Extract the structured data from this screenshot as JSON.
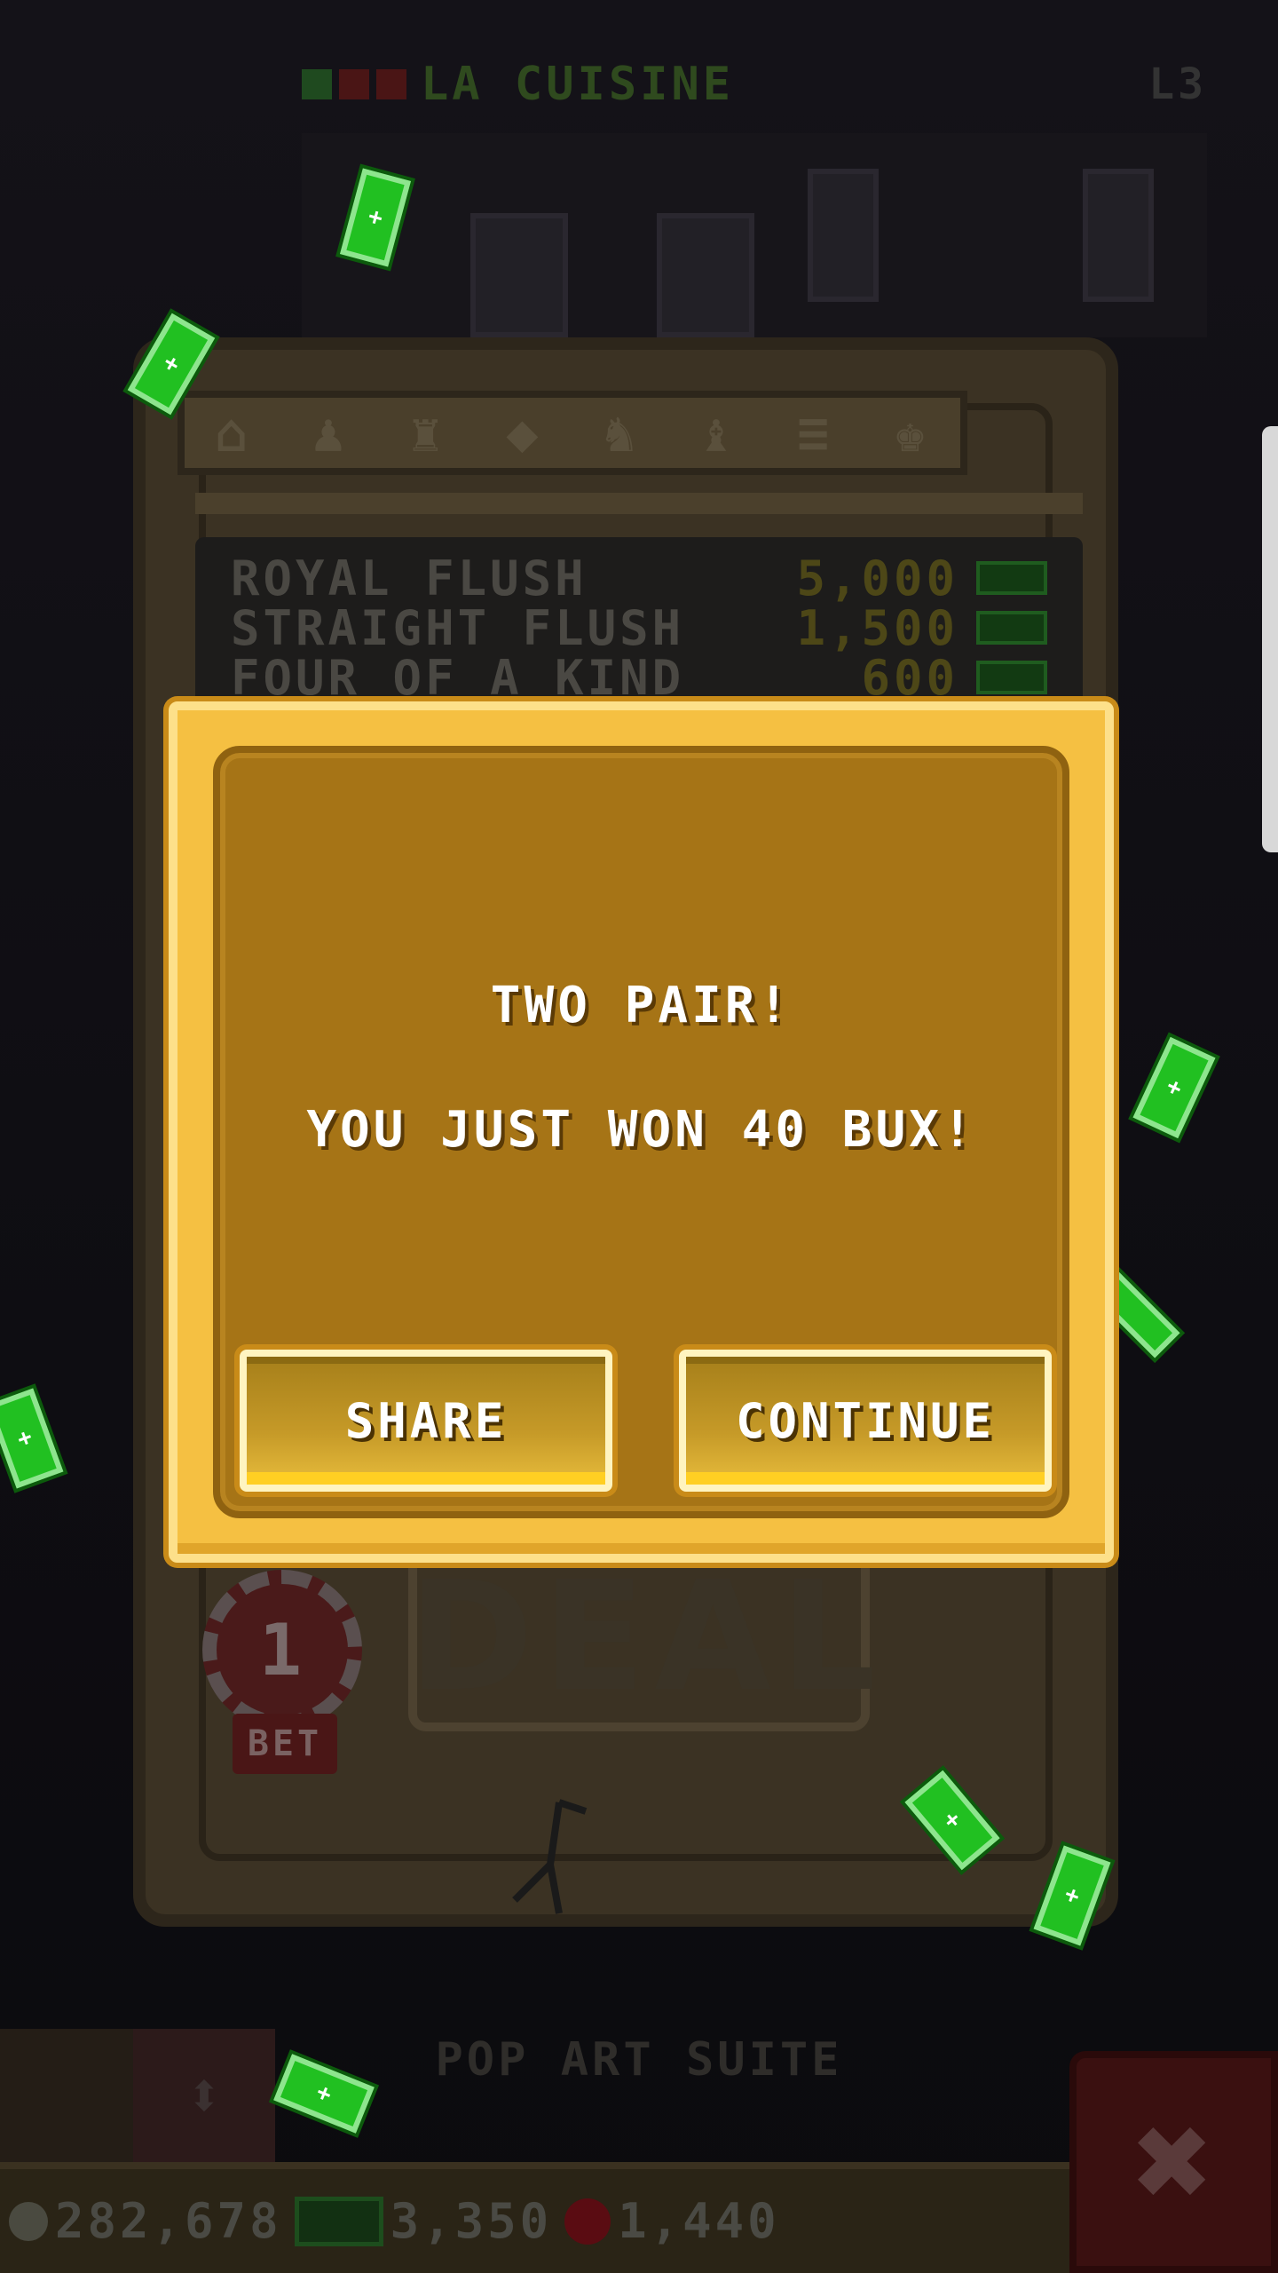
{
  "hud": {
    "floor_name": "LA CUISINE",
    "floor_level": "L3"
  },
  "machine": {
    "symbols": [
      "⌂",
      "♟",
      "♜",
      "◆",
      "♞",
      "♝",
      "≡",
      "♚"
    ],
    "paytable": [
      {
        "hand": "ROYAL FLUSH",
        "payout": "5,000"
      },
      {
        "hand": "STRAIGHT FLUSH",
        "payout": "1,500"
      },
      {
        "hand": "FOUR OF A KIND",
        "payout": "600"
      }
    ],
    "deal_label": "DEAL",
    "bet_chip_value": "1",
    "bet_label": "BET"
  },
  "dialog": {
    "title": "TWO PAIR!",
    "message": "YOU JUST WON 40 BUX!",
    "share_label": "SHARE",
    "continue_label": "CONTINUE"
  },
  "footer": {
    "suite_name": "POP ART SUITE",
    "coins": "282,678",
    "bux": "3,350",
    "chips": "1,440",
    "close_icon": "close-icon",
    "elevator_icon": "elevator-arrows-icon"
  },
  "colors": {
    "dialog_gold": "#f5c042",
    "dialog_panel": "#a67416",
    "bill_green": "#21c021"
  }
}
